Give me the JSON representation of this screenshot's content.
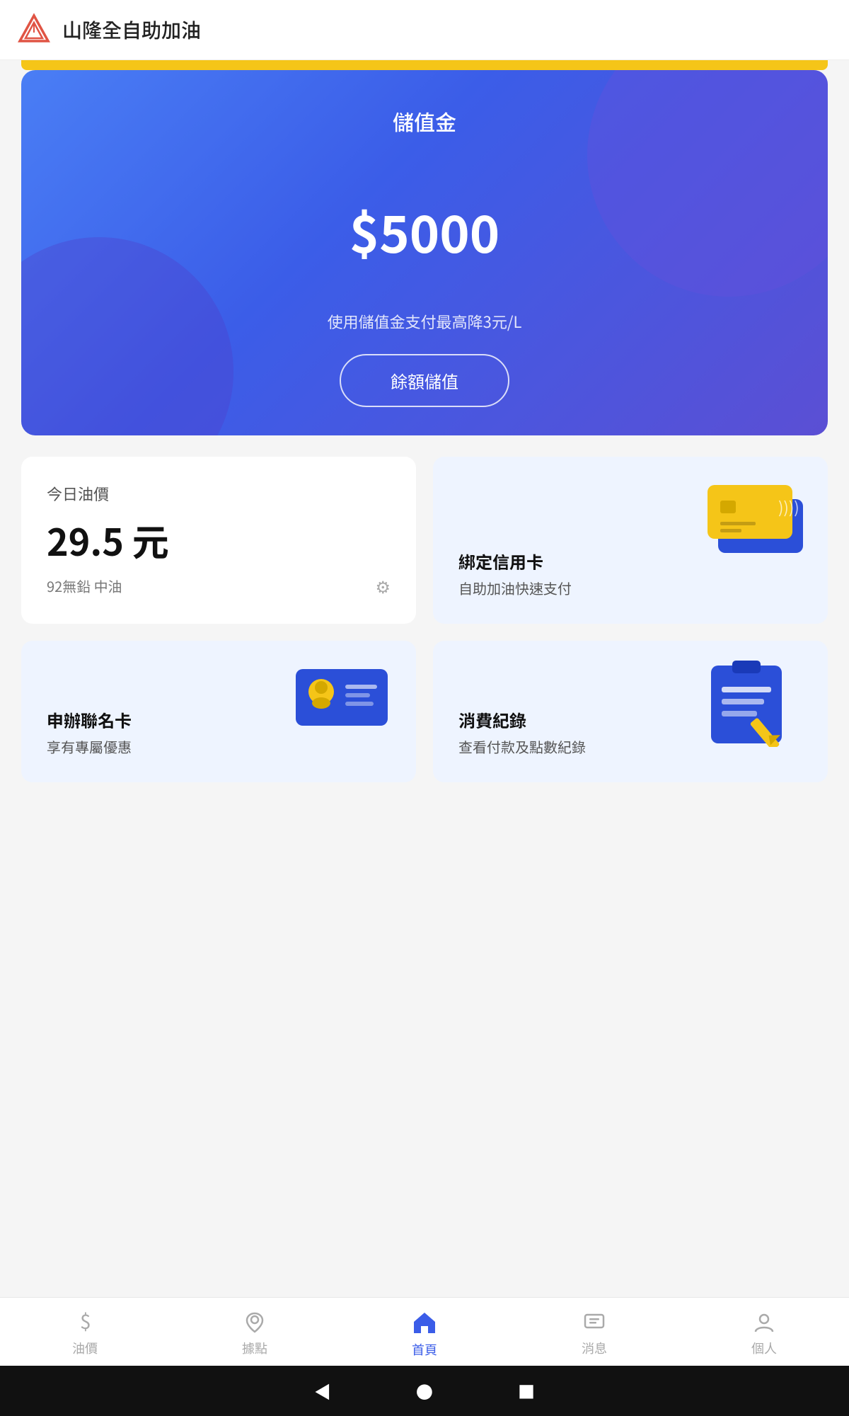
{
  "header": {
    "title": "山隆全自助加油",
    "logo_alt": "mountain-logo"
  },
  "balance_card": {
    "title": "儲值金",
    "amount": "$5000",
    "description": "使用儲值金支付最高降3元/L",
    "button_label": "餘額儲值"
  },
  "oil_price_card": {
    "label": "今日油價",
    "price": "29.5 元",
    "sub_label": "92無鉛 中油"
  },
  "credit_card_feature": {
    "title": "綁定信用卡",
    "desc": "自助加油快速支付"
  },
  "membership_feature": {
    "title": "申辦聯名卡",
    "desc": "享有專屬優惠"
  },
  "record_feature": {
    "title": "消費紀錄",
    "desc": "查看付款及點數紀錄"
  },
  "bottom_nav": {
    "items": [
      {
        "label": "油價",
        "icon": "dollar",
        "active": false
      },
      {
        "label": "據點",
        "icon": "location",
        "active": false
      },
      {
        "label": "首頁",
        "icon": "home",
        "active": true
      },
      {
        "label": "消息",
        "icon": "message",
        "active": false
      },
      {
        "label": "個人",
        "icon": "person",
        "active": false
      }
    ]
  },
  "android_nav": {
    "back": "◀",
    "home": "●",
    "recent": "■"
  }
}
